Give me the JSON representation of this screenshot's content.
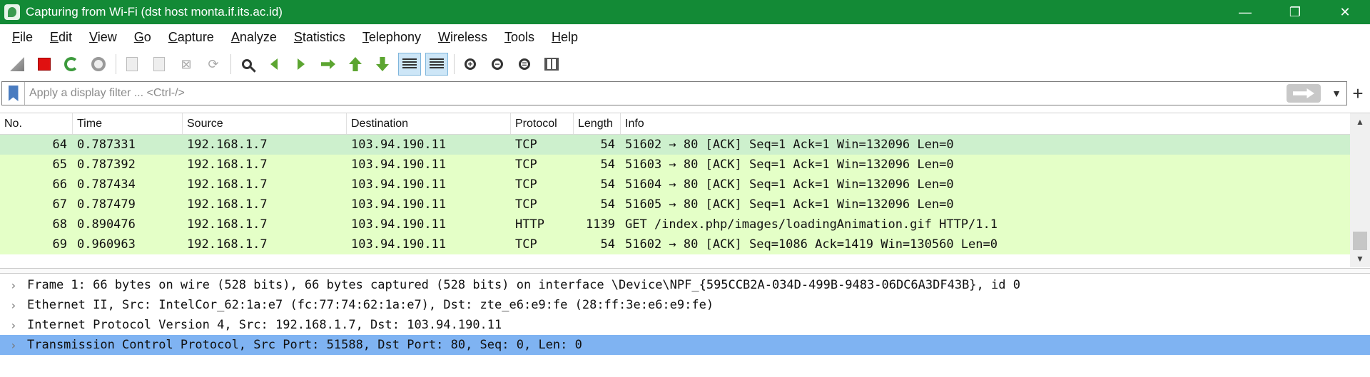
{
  "window": {
    "title": "Capturing from Wi-Fi (dst host monta.if.its.ac.id)",
    "minimize": "—",
    "maximize": "❐",
    "close": "✕",
    "app_icon": "wireshark-fin-icon"
  },
  "menu": [
    "File",
    "Edit",
    "View",
    "Go",
    "Capture",
    "Analyze",
    "Statistics",
    "Telephony",
    "Wireless",
    "Tools",
    "Help"
  ],
  "toolbar": {
    "icons": [
      "start-capture-icon",
      "stop-capture-icon",
      "restart-capture-icon",
      "capture-options-icon",
      "open-file-icon",
      "save-file-icon",
      "close-file-icon",
      "reload-file-icon",
      "find-packet-icon",
      "go-back-icon",
      "go-forward-icon",
      "go-to-packet-icon",
      "first-packet-icon",
      "last-packet-icon",
      "auto-scroll-icon",
      "colorize-icon",
      "zoom-in-icon",
      "zoom-out-icon",
      "normal-size-icon",
      "resize-columns-icon"
    ],
    "pressed": [
      "auto-scroll-icon",
      "colorize-icon"
    ]
  },
  "filter": {
    "placeholder": "Apply a display filter ... <Ctrl-/>",
    "value": "",
    "plus": "+",
    "dropdown": "▼"
  },
  "packet_list": {
    "columns": [
      "No.",
      "Time",
      "Source",
      "Destination",
      "Protocol",
      "Length",
      "Info"
    ],
    "rows": [
      {
        "no": "64",
        "time": "0.787331",
        "src": "192.168.1.7",
        "dst": "103.94.190.11",
        "proto": "TCP",
        "len": "54",
        "info": "51602 → 80 [ACK] Seq=1 Ack=1 Win=132096 Len=0"
      },
      {
        "no": "65",
        "time": "0.787392",
        "src": "192.168.1.7",
        "dst": "103.94.190.11",
        "proto": "TCP",
        "len": "54",
        "info": "51603 → 80 [ACK] Seq=1 Ack=1 Win=132096 Len=0"
      },
      {
        "no": "66",
        "time": "0.787434",
        "src": "192.168.1.7",
        "dst": "103.94.190.11",
        "proto": "TCP",
        "len": "54",
        "info": "51604 → 80 [ACK] Seq=1 Ack=1 Win=132096 Len=0"
      },
      {
        "no": "67",
        "time": "0.787479",
        "src": "192.168.1.7",
        "dst": "103.94.190.11",
        "proto": "TCP",
        "len": "54",
        "info": "51605 → 80 [ACK] Seq=1 Ack=1 Win=132096 Len=0"
      },
      {
        "no": "68",
        "time": "0.890476",
        "src": "192.168.1.7",
        "dst": "103.94.190.11",
        "proto": "HTTP",
        "len": "1139",
        "info": "GET /index.php/images/loadingAnimation.gif HTTP/1.1"
      },
      {
        "no": "69",
        "time": "0.960963",
        "src": "192.168.1.7",
        "dst": "103.94.190.11",
        "proto": "TCP",
        "len": "54",
        "info": "51602 → 80 [ACK] Seq=1086 Ack=1419 Win=130560 Len=0"
      }
    ],
    "scroll_up": "▲",
    "scroll_down": "▼"
  },
  "details": {
    "chevron": "›",
    "rows": [
      "Frame 1: 66 bytes on wire (528 bits), 66 bytes captured (528 bits) on interface \\Device\\NPF_{595CCB2A-034D-499B-9483-06DC6A3DF43B}, id 0",
      "Ethernet II, Src: IntelCor_62:1a:e7 (fc:77:74:62:1a:e7), Dst: zte_e6:e9:fe (28:ff:3e:e6:e9:fe)",
      "Internet Protocol Version 4, Src: 192.168.1.7, Dst: 103.94.190.11",
      "Transmission Control Protocol, Src Port: 51588, Dst Port: 80, Seq: 0, Len: 0"
    ],
    "selected_index": 3
  },
  "colors": {
    "titlebar": "#138a36",
    "row_tcp": "#e4ffc7",
    "row_selected_detail": "#7fb3f2"
  }
}
